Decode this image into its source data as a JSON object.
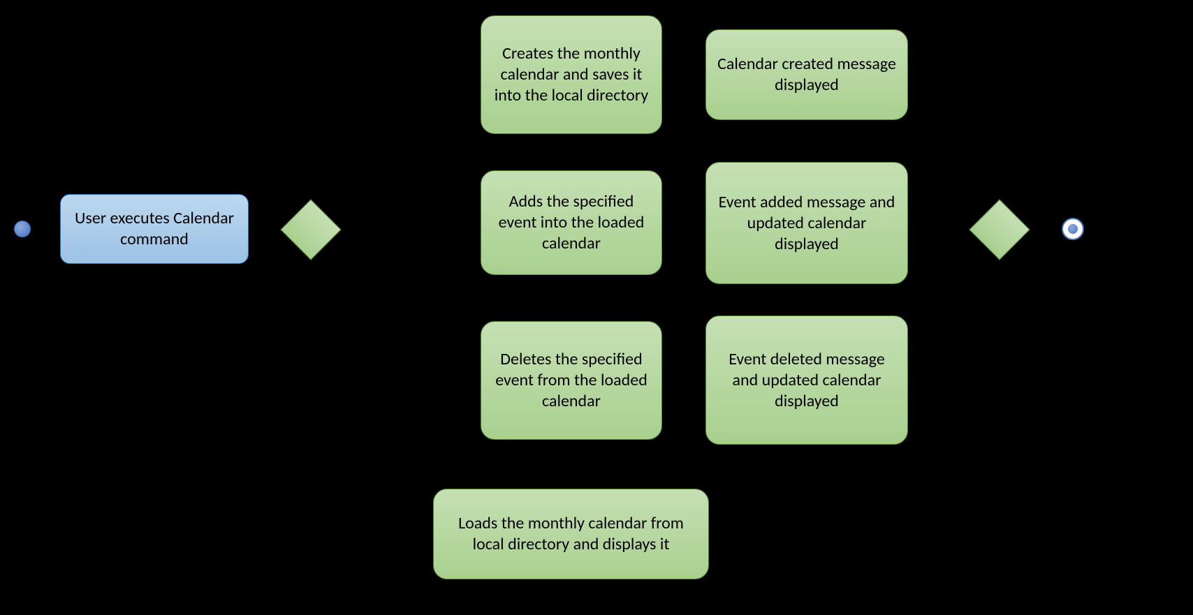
{
  "nodes": {
    "start_cmd": "User executes Calendar command",
    "create_cal": "Creates the monthly calendar and saves it into the local directory",
    "create_msg": "Calendar created message displayed",
    "add_evt": "Adds the specified event into the loaded calendar",
    "add_msg": "Event added message and updated calendar displayed",
    "del_evt": "Deletes the specified event from the loaded calendar",
    "del_msg": "Event deleted message and updated calendar displayed",
    "load_cal": "Loads the monthly calendar from local directory and displays it"
  }
}
